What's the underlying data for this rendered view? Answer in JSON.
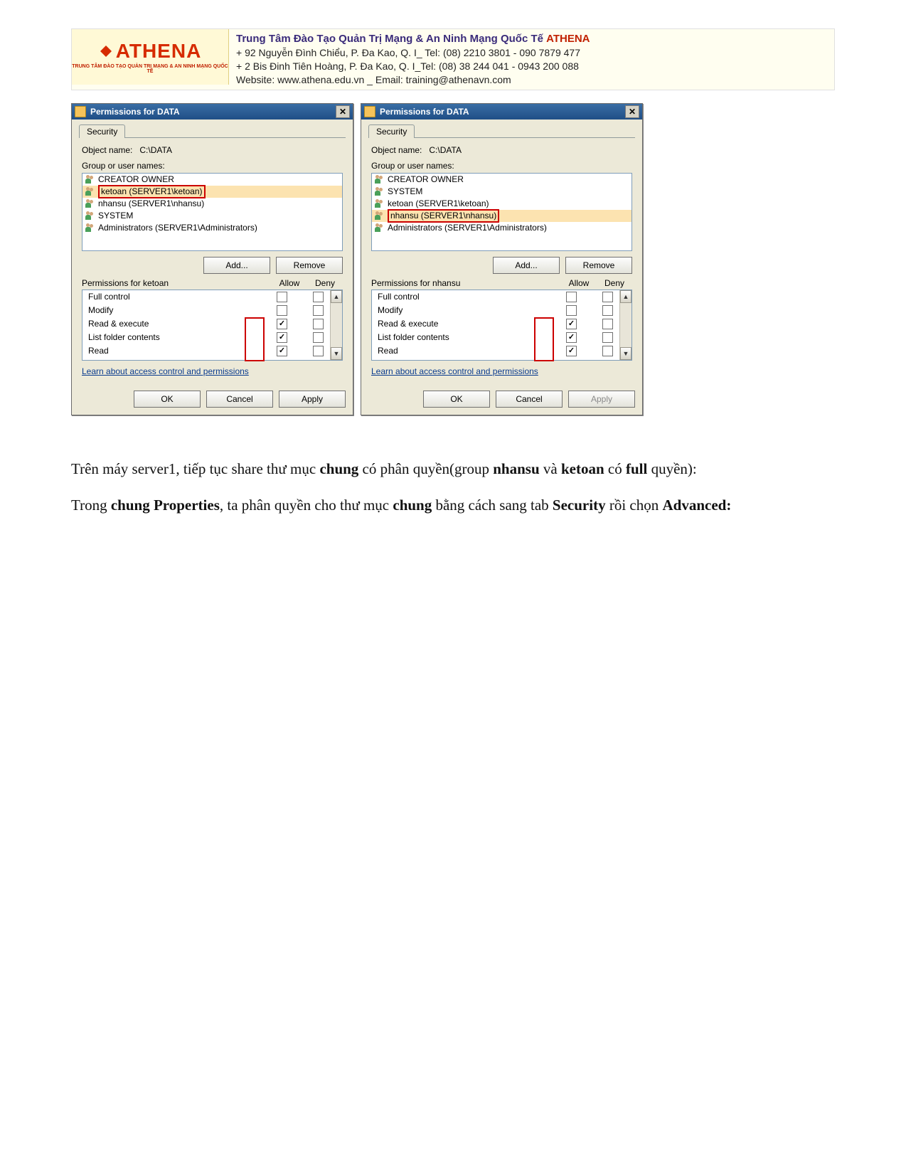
{
  "banner": {
    "logo_text": "ATHENA",
    "logo_sub": "TRUNG TÂM ĐÀO TẠO QUẢN TRỊ MẠNG & AN NINH MẠNG QUỐC TẾ",
    "line1_a": "Trung Tâm Đào Tạo Quản Trị Mạng & An Ninh Mạng Quốc Tế ",
    "line1_brand": "ATHENA",
    "line2": "+  92 Nguyễn Đình Chiểu, P. Đa Kao, Q. I_ Tel: (08) 2210 3801 -  090 7879 477",
    "line3": "+  2 Bis Đinh Tiên Hoàng, P. Đa Kao, Q. I_Tel: (08) 38 244 041 - 0943 200 088",
    "line4": "Website:  www.athena.edu.vn      _         Email: training@athenavn.com"
  },
  "dlg_left": {
    "title": "Permissions for DATA",
    "tab": "Security",
    "object_label": "Object name:",
    "object_value": "C:\\DATA",
    "group_label": "Group or user names:",
    "items": [
      "CREATOR OWNER",
      "ketoan (SERVER1\\ketoan)",
      "nhansu (SERVER1\\nhansu)",
      "SYSTEM",
      "Administrators (SERVER1\\Administrators)"
    ],
    "selected_index": 1,
    "add": "Add...",
    "remove": "Remove",
    "perm_for": "Permissions for ketoan",
    "allow": "Allow",
    "deny": "Deny",
    "perms": [
      {
        "name": "Full control",
        "allow": false,
        "deny": false
      },
      {
        "name": "Modify",
        "allow": false,
        "deny": false
      },
      {
        "name": "Read & execute",
        "allow": true,
        "deny": false
      },
      {
        "name": "List folder contents",
        "allow": true,
        "deny": false
      },
      {
        "name": "Read",
        "allow": true,
        "deny": false
      }
    ],
    "link": "Learn about access control and permissions",
    "ok": "OK",
    "cancel": "Cancel",
    "apply": "Apply",
    "apply_disabled": false
  },
  "dlg_right": {
    "title": "Permissions for DATA",
    "tab": "Security",
    "object_label": "Object name:",
    "object_value": "C:\\DATA",
    "group_label": "Group or user names:",
    "items": [
      "CREATOR OWNER",
      "SYSTEM",
      "ketoan (SERVER1\\ketoan)",
      "nhansu (SERVER1\\nhansu)",
      "Administrators (SERVER1\\Administrators)"
    ],
    "selected_index": 3,
    "add": "Add...",
    "remove": "Remove",
    "perm_for": "Permissions for nhansu",
    "allow": "Allow",
    "deny": "Deny",
    "perms": [
      {
        "name": "Full control",
        "allow": false,
        "deny": false
      },
      {
        "name": "Modify",
        "allow": false,
        "deny": false
      },
      {
        "name": "Read & execute",
        "allow": true,
        "deny": false
      },
      {
        "name": "List folder contents",
        "allow": true,
        "deny": false
      },
      {
        "name": "Read",
        "allow": true,
        "deny": false
      }
    ],
    "link": "Learn about access control and permissions",
    "ok": "OK",
    "cancel": "Cancel",
    "apply": "Apply",
    "apply_disabled": true
  },
  "article": {
    "p1_a": "Trên máy server1, tiếp tục share thư mục ",
    "p1_b": "chung",
    "p1_c": " có phân quyền(group ",
    "p1_d": "nhansu",
    "p1_e": " và ",
    "p1_f": "ketoan",
    "p1_g": " có ",
    "p1_h": "full",
    "p1_i": " quyền):",
    "p2_a": "Trong ",
    "p2_b": "chung Properties",
    "p2_c": ", ta phân quyền cho thư mục ",
    "p2_d": "chung",
    "p2_e": " bằng cách sang tab ",
    "p2_f": "Security",
    "p2_g": " rồi chọn ",
    "p2_h": "Advanced:"
  }
}
